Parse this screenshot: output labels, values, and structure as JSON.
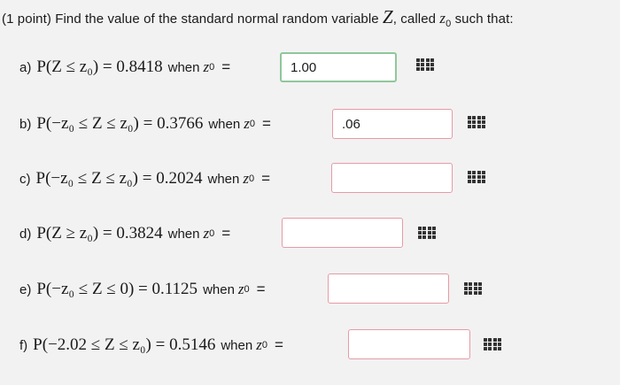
{
  "header": {
    "prefix": "(1 point) Find the value of the standard normal random variable ",
    "var_Z": "Z",
    "mid": ", called ",
    "var_z0": "z",
    "sub0": "0",
    "suffix": " such that:"
  },
  "questions": [
    {
      "label": "a)",
      "expr": "P(Z ≤ z₀) = 0.8418",
      "when": "when",
      "z": "z",
      "sub": "0",
      "eq": "=",
      "answer": "1.00",
      "state": "filled"
    },
    {
      "label": "b)",
      "expr": "P(−z₀ ≤ Z ≤ z₀) = 0.3766",
      "when": "when",
      "z": "z",
      "sub": "0",
      "eq": "=",
      "answer": ".06",
      "state": "empty"
    },
    {
      "label": "c)",
      "expr": "P(−z₀ ≤ Z ≤ z₀) = 0.2024",
      "when": "when",
      "z": "z",
      "sub": "0",
      "eq": "=",
      "answer": "",
      "state": "empty"
    },
    {
      "label": "d)",
      "expr": "P(Z ≥ z₀) = 0.3824",
      "when": "when",
      "z": "z",
      "sub": "0",
      "eq": "=",
      "answer": "",
      "state": "empty"
    },
    {
      "label": "e)",
      "expr": "P(−z₀ ≤ Z ≤ 0) = 0.1125",
      "when": "when",
      "z": "z",
      "sub": "0",
      "eq": "=",
      "answer": "",
      "state": "empty"
    },
    {
      "label": "f)",
      "expr": "P(−2.02 ≤ Z ≤ z₀) = 0.5146",
      "when": "when",
      "z": "z",
      "sub": "0",
      "eq": "=",
      "answer": "",
      "state": "empty"
    }
  ],
  "icons": {
    "keypad": "grid-keypad-icon"
  },
  "colors": {
    "filled_border": "#8fc79a",
    "empty_border": "#e79aa6"
  }
}
